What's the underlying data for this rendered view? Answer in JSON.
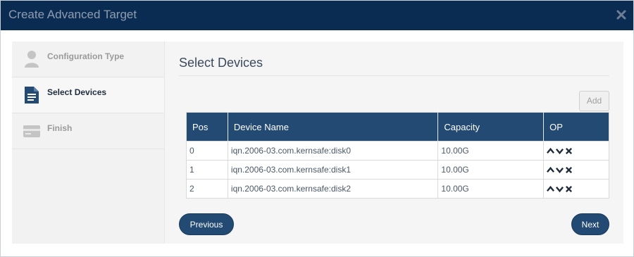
{
  "dialog": {
    "title": "Create Advanced Target",
    "close_icon": "close-icon"
  },
  "sidebar": {
    "steps": [
      {
        "label": "Configuration Type",
        "icon": "user-icon",
        "active": false
      },
      {
        "label": "Select Devices",
        "icon": "document-icon",
        "active": true
      },
      {
        "label": "Finish",
        "icon": "card-icon",
        "active": false
      }
    ]
  },
  "content": {
    "title": "Select Devices",
    "add_label": "Add",
    "table": {
      "headers": [
        "Pos",
        "Device Name",
        "Capacity",
        "OP"
      ],
      "rows": [
        {
          "pos": "0",
          "name": "iqn.2006-03.com.kernsafe:disk0",
          "capacity": "10.00G"
        },
        {
          "pos": "1",
          "name": "iqn.2006-03.com.kernsafe:disk1",
          "capacity": "10.00G"
        },
        {
          "pos": "2",
          "name": "iqn.2006-03.com.kernsafe:disk2",
          "capacity": "10.00G"
        }
      ],
      "op_icons": [
        "move-up-icon",
        "move-down-icon",
        "delete-icon"
      ]
    },
    "previous_label": "Previous",
    "next_label": "Next"
  },
  "colors": {
    "titlebar": "#0b2c52",
    "accent": "#234a72",
    "panel": "#f5f5f5"
  }
}
